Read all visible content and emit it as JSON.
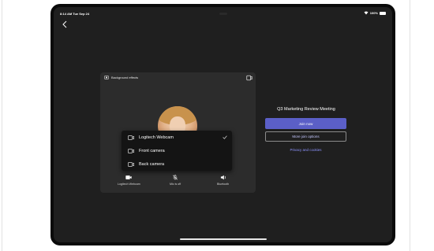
{
  "status_bar": {
    "time": "8:14 AM  Tue Sep 24",
    "battery": "100%"
  },
  "icons": {
    "back": "chevron-left-icon",
    "background_effects": "background-effects-icon",
    "camera_switch": "camera-switch-icon",
    "webcam": "webcam-icon",
    "camera": "camera-icon",
    "check": "checkmark-icon",
    "mic_off": "mic-off-icon",
    "speaker": "speaker-icon"
  },
  "preview": {
    "background_effects_label": "Background effects"
  },
  "camera_menu": {
    "items": [
      {
        "label": "Logitech Webcam",
        "selected": true
      },
      {
        "label": "Front camera",
        "selected": false
      },
      {
        "label": "Back camera",
        "selected": false
      }
    ]
  },
  "controls": {
    "camera_label": "Logitech Webcam",
    "mic_label": "Mic is off",
    "audio_label": "Bluetooth"
  },
  "meeting": {
    "title": "Q3 Marketing Review Meeting",
    "join_label": "Join now",
    "more_options_label": "More join options",
    "privacy_label": "Privacy and cookies"
  },
  "colors": {
    "accent": "#5b5fc7",
    "link": "#8e94ff",
    "screen_bg": "#1f1f1f",
    "panel_bg": "#2c2c2c"
  }
}
